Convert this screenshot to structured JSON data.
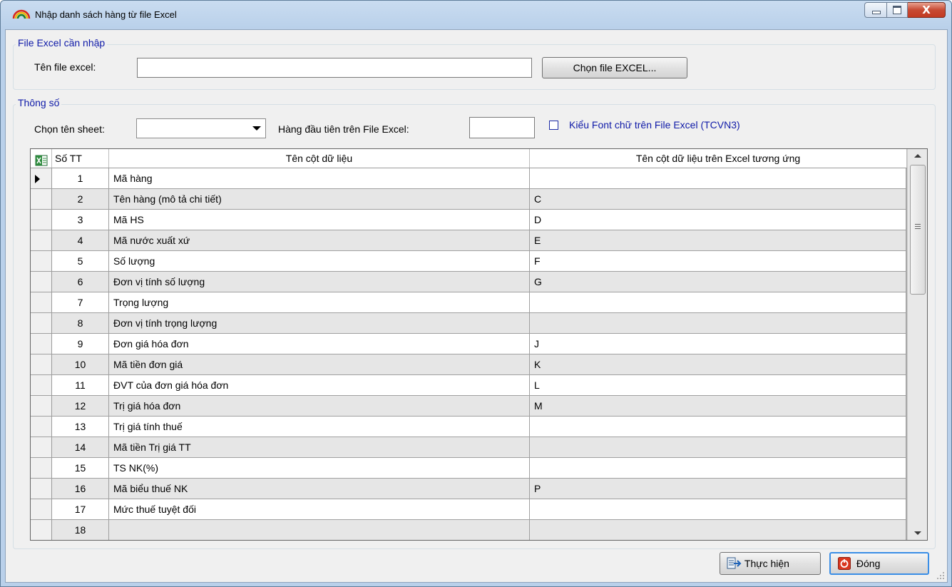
{
  "window": {
    "title": "Nhập danh sách hàng từ file Excel",
    "close_glyph": "X"
  },
  "file_group": {
    "legend": "File Excel cần nhập",
    "filename_label": "Tên file excel:",
    "filename_value": "",
    "choose_button": "Chọn file EXCEL..."
  },
  "params_group": {
    "legend": "Thông số",
    "sheet_label": "Chọn tên sheet:",
    "sheet_value": "",
    "first_row_label": "Hàng đầu tiên trên File Excel:",
    "first_row_value": "",
    "font_checkbox_label": "Kiểu Font chữ trên File Excel (TCVN3)",
    "font_checkbox_checked": false
  },
  "grid": {
    "columns": {
      "stt": "Số TT",
      "name": "Tên cột dữ liệu",
      "excel": "Tên cột dữ liệu trên Excel tương ứng"
    },
    "rows": [
      {
        "stt": "1",
        "name": "Mã hàng",
        "excel": ""
      },
      {
        "stt": "2",
        "name": "Tên hàng (mô tả chi tiết)",
        "excel": "C"
      },
      {
        "stt": "3",
        "name": "Mã HS",
        "excel": "D"
      },
      {
        "stt": "4",
        "name": "Mã nước xuất xứ",
        "excel": "E"
      },
      {
        "stt": "5",
        "name": "Số lượng",
        "excel": "F"
      },
      {
        "stt": "6",
        "name": "Đơn vị tính số lượng",
        "excel": "G"
      },
      {
        "stt": "7",
        "name": "Trọng lượng",
        "excel": ""
      },
      {
        "stt": "8",
        "name": "Đơn vị tính trọng lượng",
        "excel": ""
      },
      {
        "stt": "9",
        "name": "Đơn giá hóa đơn",
        "excel": "J"
      },
      {
        "stt": "10",
        "name": "Mã tiền đơn giá",
        "excel": "K"
      },
      {
        "stt": "11",
        "name": "ĐVT của đơn giá hóa đơn",
        "excel": "L"
      },
      {
        "stt": "12",
        "name": "Trị giá hóa đơn",
        "excel": "M"
      },
      {
        "stt": "13",
        "name": "Trị giá tính thuế",
        "excel": ""
      },
      {
        "stt": "14",
        "name": "Mã tiền Trị giá TT",
        "excel": ""
      },
      {
        "stt": "15",
        "name": "TS NK(%)",
        "excel": ""
      },
      {
        "stt": "16",
        "name": "Mã biểu thuế NK",
        "excel": "P"
      },
      {
        "stt": "17",
        "name": "Mức thuế tuyệt đối",
        "excel": ""
      },
      {
        "stt": "18",
        "name": "",
        "excel": ""
      }
    ],
    "current_row": 1
  },
  "footer": {
    "execute_button": "Thực hiện",
    "close_button": "Đóng"
  }
}
